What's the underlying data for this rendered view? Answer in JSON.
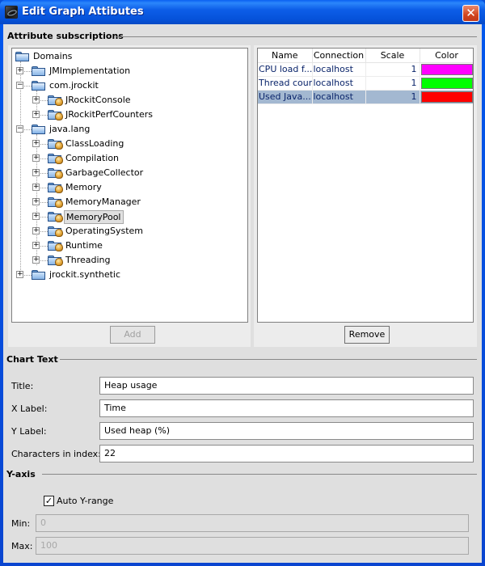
{
  "window": {
    "title": "Edit Graph Attibutes"
  },
  "icons": {
    "close": "close-icon",
    "app": "app-icon",
    "folder": "folder-icon",
    "mbean": "mbean-icon",
    "check": "check-icon"
  },
  "attributes": {
    "section_label": "Attribute subscriptions",
    "tree": {
      "nodes": [
        {
          "label": "Domains",
          "depth": 0,
          "type": "folder-open",
          "expander": ""
        },
        {
          "label": "JMImplementation",
          "depth": 1,
          "type": "folder",
          "expander": "+"
        },
        {
          "label": "com.jrockit",
          "depth": 1,
          "type": "folder-open",
          "expander": "-"
        },
        {
          "label": "JRockitConsole",
          "depth": 2,
          "type": "mbean",
          "expander": "+"
        },
        {
          "label": "JRockitPerfCounters",
          "depth": 2,
          "type": "mbean",
          "expander": "+"
        },
        {
          "label": "java.lang",
          "depth": 1,
          "type": "folder-open",
          "expander": "-"
        },
        {
          "label": "ClassLoading",
          "depth": 2,
          "type": "mbean",
          "expander": "+"
        },
        {
          "label": "Compilation",
          "depth": 2,
          "type": "mbean",
          "expander": "+"
        },
        {
          "label": "GarbageCollector",
          "depth": 2,
          "type": "mbean",
          "expander": "+"
        },
        {
          "label": "Memory",
          "depth": 2,
          "type": "mbean",
          "expander": "+"
        },
        {
          "label": "MemoryManager",
          "depth": 2,
          "type": "mbean",
          "expander": "+"
        },
        {
          "label": "MemoryPool",
          "depth": 2,
          "type": "mbean",
          "expander": "+",
          "selected": true
        },
        {
          "label": "OperatingSystem",
          "depth": 2,
          "type": "mbean",
          "expander": "+"
        },
        {
          "label": "Runtime",
          "depth": 2,
          "type": "mbean",
          "expander": "+"
        },
        {
          "label": "Threading",
          "depth": 2,
          "type": "mbean",
          "expander": "+"
        },
        {
          "label": "jrockit.synthetic",
          "depth": 1,
          "type": "folder",
          "expander": "+"
        }
      ]
    },
    "table": {
      "columns": [
        "Name",
        "Connection",
        "Scale",
        "Color"
      ],
      "rows": [
        {
          "name": "CPU load f...",
          "connection": "localhost",
          "scale": "1",
          "color": "#ff00ff",
          "selected": false
        },
        {
          "name": "Thread count",
          "connection": "localhost",
          "scale": "1",
          "color": "#00ff00",
          "selected": false
        },
        {
          "name": "Used Java...",
          "connection": "localhost",
          "scale": "1",
          "color": "#ff0000",
          "selected": true
        }
      ]
    },
    "add_label": "Add",
    "remove_label": "Remove"
  },
  "chart_text": {
    "section_label": "Chart Text",
    "title_label": "Title:",
    "title_value": "Heap usage",
    "xlabel_label": "X Label:",
    "xlabel_value": "Time",
    "ylabel_label": "Y Label:",
    "ylabel_value": "Used heap (%)",
    "chars_label": "Characters in index:",
    "chars_value": "22"
  },
  "y_axis": {
    "section_label": "Y-axis",
    "auto_label": "Auto Y-range",
    "auto_checked": true,
    "min_label": "Min:",
    "min_value": "0",
    "max_label": "Max:",
    "max_value": "100"
  }
}
